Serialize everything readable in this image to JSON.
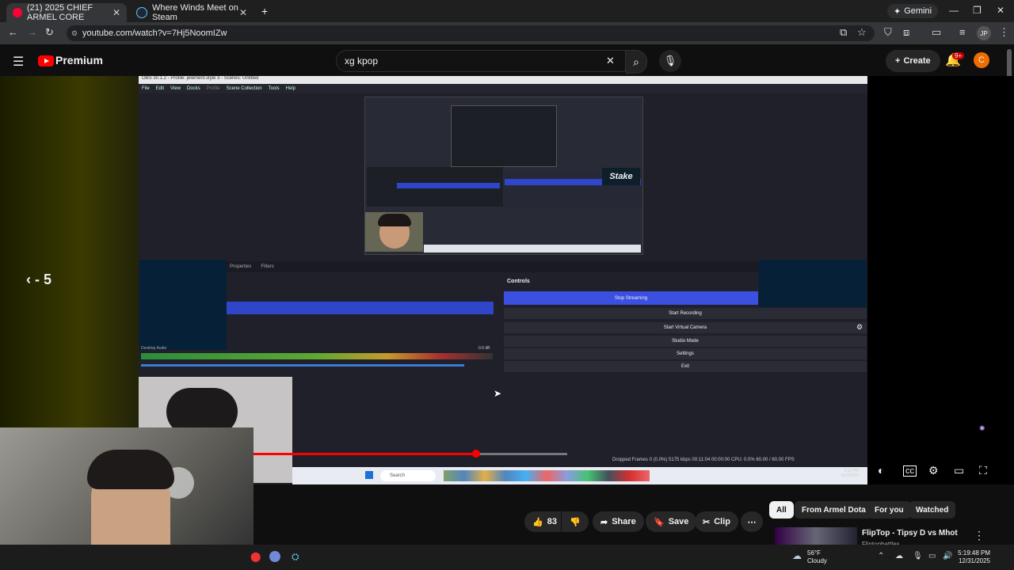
{
  "browser": {
    "tabs": [
      {
        "title": "(21) 2025 CHIEF ARMEL CORE",
        "favicon_color": "#ff0033"
      },
      {
        "title": "Where Winds Meet on Steam",
        "favicon_color": "#1b2838"
      }
    ],
    "close_glyph": "✕",
    "new_tab_glyph": "+",
    "gemini_label": "Gemini",
    "window_controls": [
      "—",
      "❐",
      "✕"
    ],
    "url": "youtube.com/watch?v=7Hj5NoomIZw",
    "profile_initials": "JP"
  },
  "youtube": {
    "logo_label": "Premium",
    "search_query": "xg kpop",
    "create_label": "Create",
    "notifications_badge": "9+",
    "avatar_initial": "C",
    "seek_label": "- 5",
    "progress_fraction": 0.71,
    "actions": {
      "like_count": "83",
      "share_label": "Share",
      "save_label": "Save",
      "clip_label": "Clip"
    },
    "chips": [
      "All",
      "From Armel Dota",
      "For you",
      "Watched"
    ],
    "recommendation": {
      "title": "FlipTop - Tipsy D vs Mhot",
      "channel": "Fliptopbattles"
    }
  },
  "obs": {
    "title": "OBS 30.1.2 - Profile: jelement.style 3 - Scenes: Untitled",
    "menu": [
      "File",
      "Edit",
      "View",
      "Docks",
      "Profile",
      "Scene Collection",
      "Tools",
      "Help"
    ],
    "stake_logo": "Stake",
    "tabs": [
      "Properties",
      "Filters"
    ],
    "controls_title": "Controls",
    "controls": [
      "Stop Streaming",
      "Start Recording",
      "Start Virtual Camera",
      "Studio Mode",
      "Settings",
      "Exit"
    ],
    "mixer_label": "Desktop Audio",
    "mixer_db": "0.0 dB",
    "status": "Dropped Frames 0 (0.0%)   5175 kbps   00:11:04   00:00:00   CPU: 0.0%   60.00 / 60.00 FPS",
    "taskbar_search": "Search",
    "clock_time": "3:12 PM",
    "clock_date": "6/22/2025"
  },
  "windows": {
    "weather_temp": "56°F",
    "weather_text": "Cloudy",
    "time": "5:19:48 PM",
    "date": "12/31/2025"
  },
  "colors": {
    "accent_red": "#ff0000",
    "obs_blue": "#3b4fe0"
  }
}
